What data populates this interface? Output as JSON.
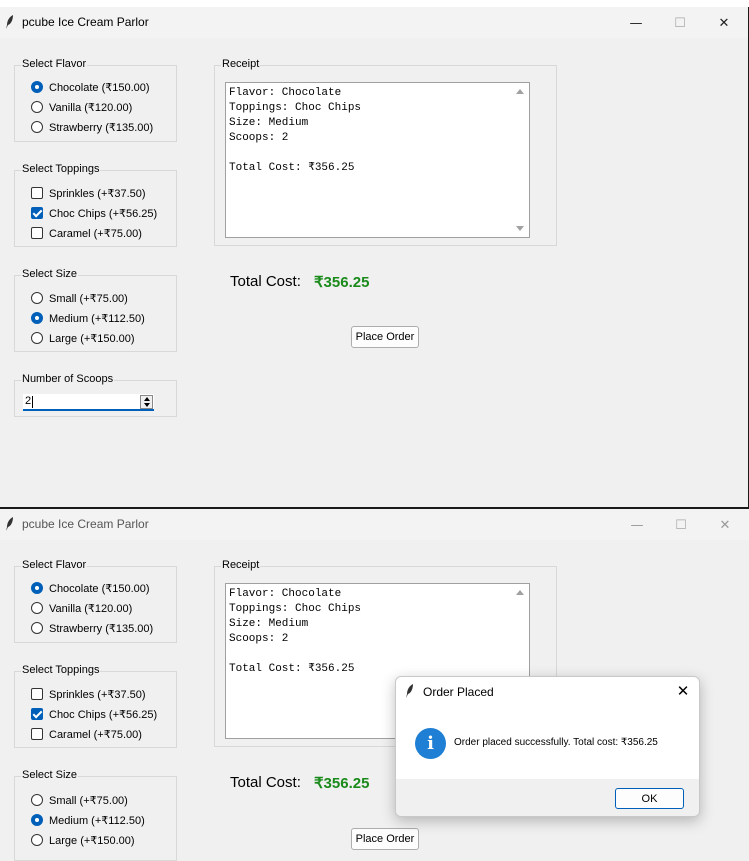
{
  "app": {
    "title": "pcube Ice Cream Parlor",
    "window_controls": {
      "minimize": "—",
      "maximize": "☐",
      "close": "✕"
    }
  },
  "flavor": {
    "label": "Select Flavor",
    "options": [
      "Chocolate (₹150.00)",
      "Vanilla (₹120.00)",
      "Strawberry (₹135.00)"
    ],
    "selected": "Chocolate (₹150.00)"
  },
  "toppings": {
    "label": "Select Toppings",
    "options": [
      "Sprinkles (+₹37.50)",
      "Choc Chips (+₹56.25)",
      "Caramel (+₹75.00)"
    ],
    "checked": [
      "Choc Chips (+₹56.25)"
    ]
  },
  "size": {
    "label": "Select Size",
    "options": [
      "Small (+₹75.00)",
      "Medium (+₹112.50)",
      "Large (+₹150.00)"
    ],
    "selected": "Medium (+₹112.50)"
  },
  "scoops": {
    "label": "Number of Scoops",
    "value": "2"
  },
  "receipt": {
    "label": "Receipt",
    "text": "Flavor: Chocolate\nToppings: Choc Chips\nSize: Medium\nScoops: 2\n\nTotal Cost: ₹356.25"
  },
  "total": {
    "label": "Total Cost:",
    "value": "₹356.25",
    "value_color": "#1a8a1a"
  },
  "place_order_button": "Place Order",
  "dialog": {
    "title": "Order Placed",
    "message": "Order placed successfully. Total cost: ₹356.25",
    "ok_button": "OK",
    "close": "✕",
    "icon": "info-icon"
  },
  "colors": {
    "accent": "#005fb8",
    "info_icon": "#1e7fd4"
  }
}
